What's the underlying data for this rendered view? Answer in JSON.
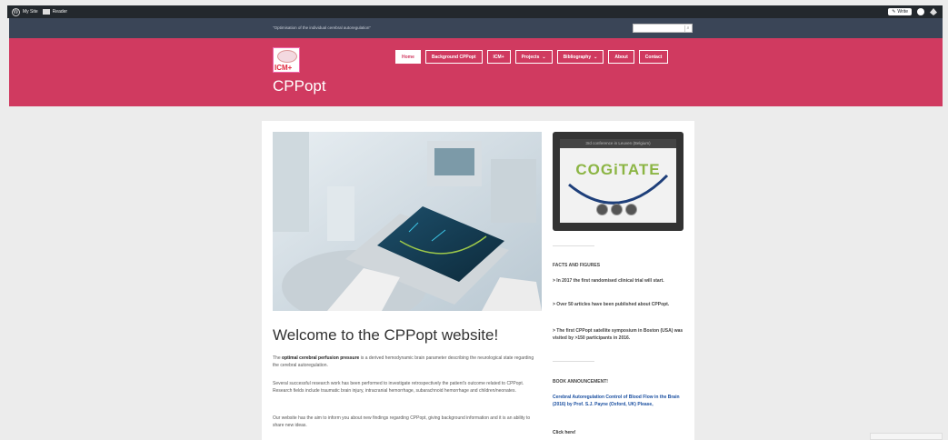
{
  "adminbar": {
    "my_site": "My Site",
    "reader": "Reader",
    "write": "Write"
  },
  "topbar": {
    "tagline": "\"Optimisation of the individual cerebral autoregulation\"",
    "search_placeholder": ""
  },
  "header": {
    "logo_text": "ICM+",
    "site_title": "CPPopt",
    "nav": [
      {
        "label": "Home",
        "active": true
      },
      {
        "label": "Background CPPopt"
      },
      {
        "label": "ICM+"
      },
      {
        "label": "Projects"
      },
      {
        "label": "Bibliography"
      },
      {
        "label": "About"
      },
      {
        "label": "Contact"
      }
    ]
  },
  "main": {
    "welcome_title": "Welcome to the CPPopt website!",
    "para1_prefix": "The ",
    "para1_bold": "optimal cerebral perfusion pressure",
    "para1_suffix": " is a derived hemodynamic brain parameter describing the neurological state regarding the cerebral autoregulation.",
    "para2": "Several successful research work has been performed to investigate retrospectively the patient's outcome related to CPPopt. Research fields include traumatic brain injury, intracranial hemorrhage, subarachnoid hemorrhage and children/neonates.",
    "para3": "Our website has the aim to inform you about new findings regarding CPPopt,  giving background information and it is an ability  to share new ideas."
  },
  "sidebar": {
    "video_title": "3rd conference in Leuven (Belgium)",
    "video_brand": "COGiTATE",
    "facts_heading": "FACTS AND FIGURES",
    "facts": [
      "> In 2017 the first randomised clinical trial will start.",
      "> Over 50 articles have been published about CPPopt.",
      "> The first CPPopt satellite symposium in Boston (USA) was visited by >150 participants in 2016."
    ],
    "book_heading": "BOOK ANNOUNCEMENT!",
    "book_text": "Cerebral Autoregulation Control of Blood Flow in the Brain (2016) by Prof. S.J. Payne (Oxford, UK) Please,",
    "click_here": "Click here!"
  },
  "colors": {
    "accent": "#d03a60",
    "topbar": "#3a4557",
    "adminbar": "#23282d",
    "link": "#1a4fa0",
    "brand_green": "#8cb544"
  }
}
